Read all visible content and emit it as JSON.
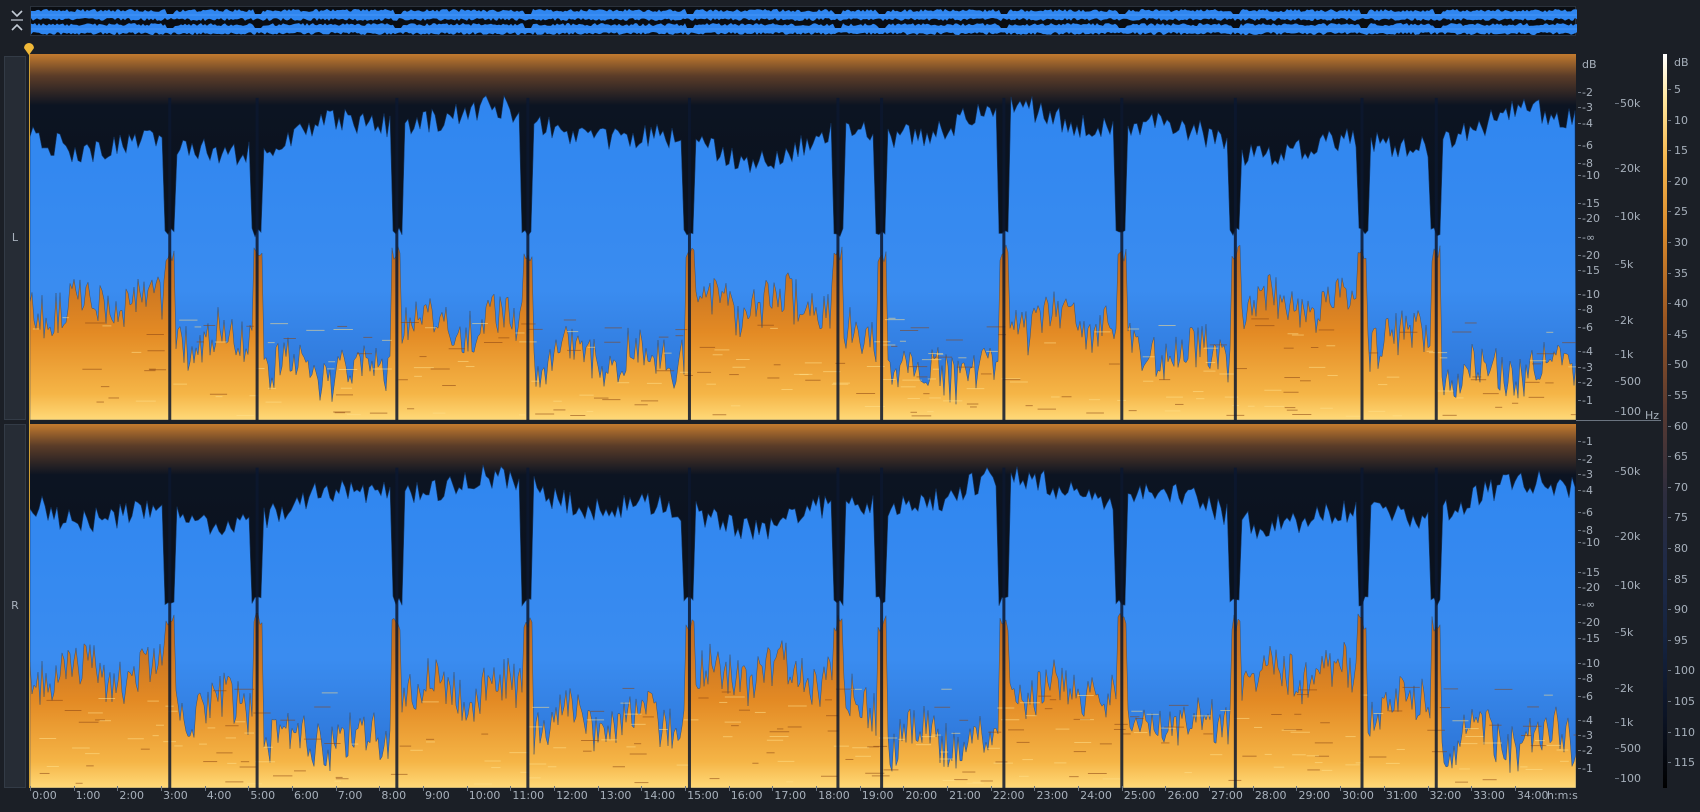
{
  "overview": {
    "label": "Waveform overview"
  },
  "controls": {
    "collapse_icon": "chevrons-collapse-icon",
    "playhead_icon": "playhead-marker-icon"
  },
  "channels": [
    {
      "id": "L",
      "label": "L"
    },
    {
      "id": "R",
      "label": "R"
    }
  ],
  "amp_scale_top": {
    "unit": "dB",
    "labels": [
      "-2",
      "-3",
      "-4",
      "-6",
      "-8",
      "-10",
      "-15",
      "-20",
      "-∞",
      "-20",
      "-15",
      "-10",
      "-8",
      "-6",
      "-4",
      "-3",
      "-2",
      "-1"
    ]
  },
  "amp_scale_bottom": {
    "labels": [
      "-1",
      "-2",
      "-3",
      "-4",
      "-6",
      "-8",
      "-10",
      "-15",
      "-20",
      "-∞",
      "-20",
      "-15",
      "-10",
      "-8",
      "-6",
      "-4",
      "-3",
      "-2",
      "-1"
    ]
  },
  "freq_scale_top": {
    "labels": [
      "50k",
      "20k",
      "10k",
      "5k",
      "2k",
      "1k",
      "500",
      "100"
    ],
    "unit": "Hz"
  },
  "freq_scale_bottom": {
    "labels": [
      "50k",
      "20k",
      "10k",
      "5k",
      "2k",
      "1k",
      "500",
      "100"
    ]
  },
  "colorbar": {
    "unit": "dB",
    "labels": [
      "5",
      "10",
      "15",
      "20",
      "25",
      "30",
      "35",
      "40",
      "45",
      "50",
      "55",
      "60",
      "65",
      "70",
      "75",
      "80",
      "85",
      "90",
      "95",
      "100",
      "105",
      "110",
      "115"
    ]
  },
  "time_axis": {
    "labels": [
      "0:00",
      "1:00",
      "2:00",
      "3:00",
      "4:00",
      "5:00",
      "6:00",
      "7:00",
      "8:00",
      "9:00",
      "10:00",
      "11:00",
      "12:00",
      "13:00",
      "14:00",
      "15:00",
      "16:00",
      "17:00",
      "18:00",
      "19:00",
      "20:00",
      "21:00",
      "22:00",
      "23:00",
      "24:00",
      "25:00",
      "26:00",
      "27:00",
      "28:00",
      "29:00",
      "30:00",
      "31:00",
      "32:00",
      "33:00",
      "34:00"
    ],
    "unit": "h:m:s"
  },
  "track_boundaries_min": [
    3.2,
    5.2,
    8.4,
    11.4,
    15.1,
    18.5,
    19.5,
    22.3,
    25.0,
    27.6,
    30.5,
    32.2
  ],
  "colors": {
    "accent_blue": "#2f86f0",
    "spectrum_orange": "#e88c20",
    "background": "#1b1f26"
  }
}
